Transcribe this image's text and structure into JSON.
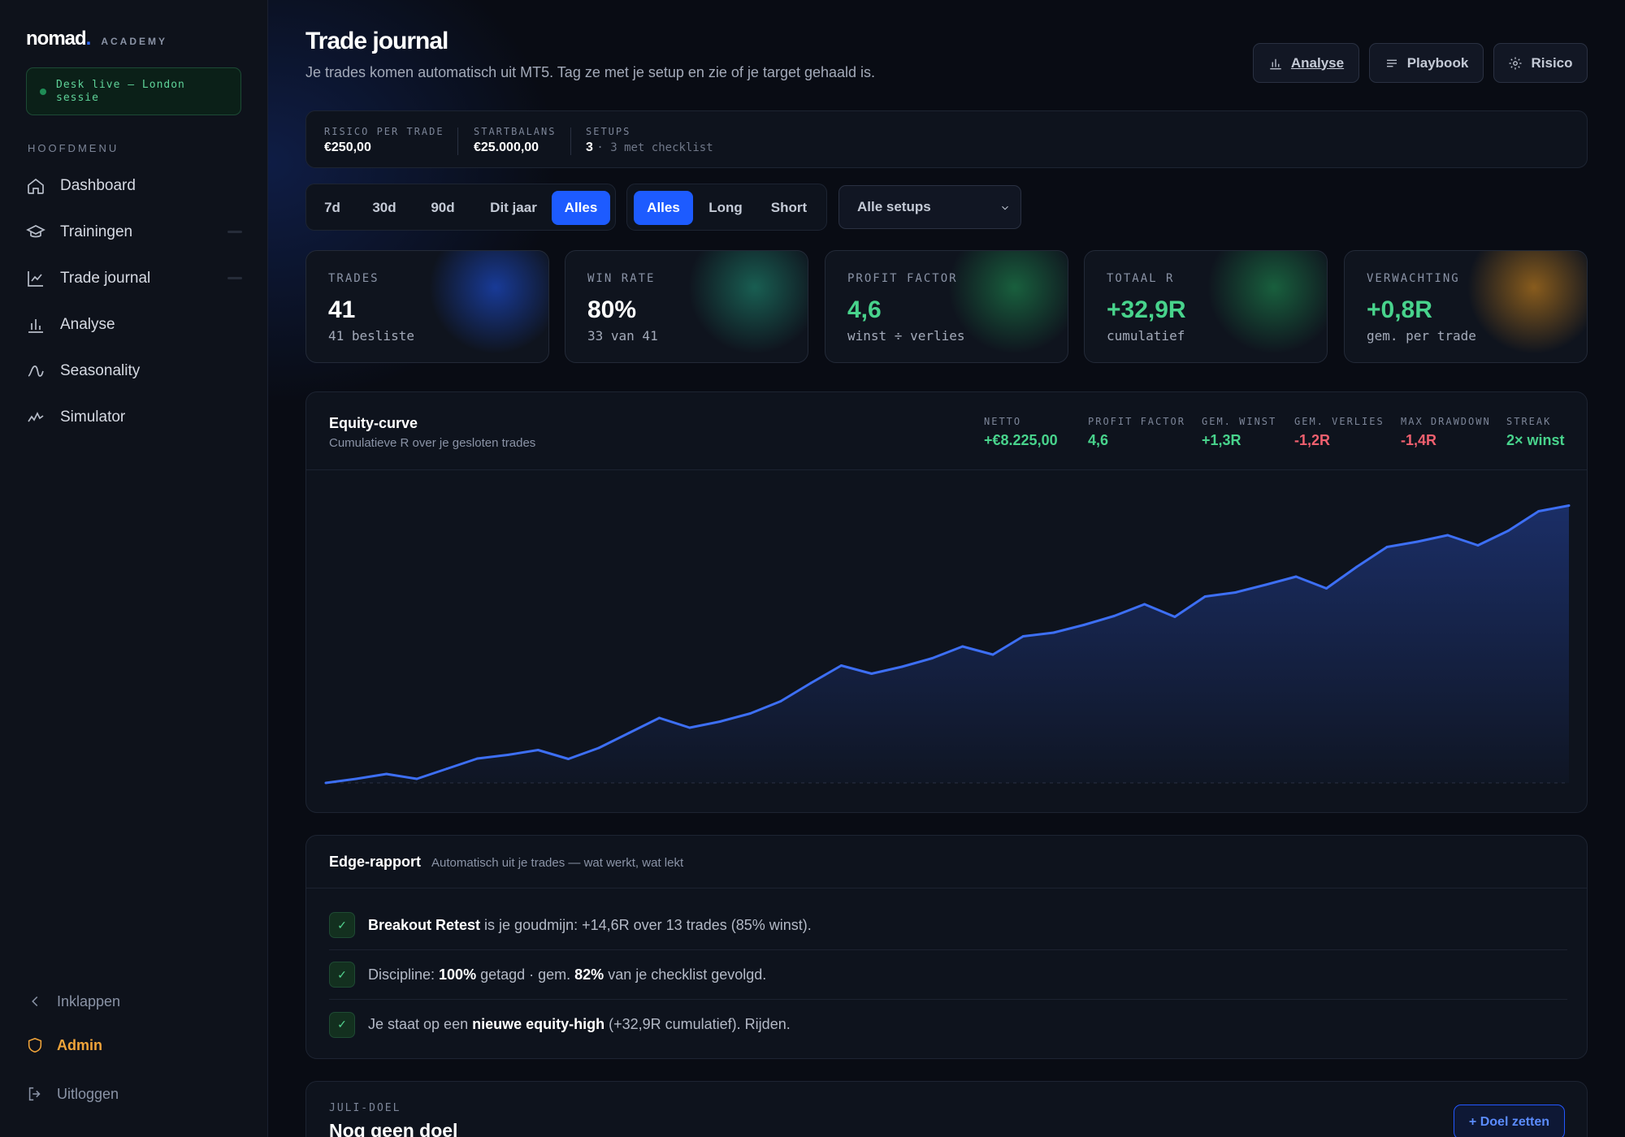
{
  "brand": {
    "name": "nomad",
    "dot": ".",
    "sub": "ACADEMY"
  },
  "live_status": "Desk live – London sessie",
  "sidebar": {
    "menu_title": "HOOFDMENU",
    "items": [
      {
        "label": "Dashboard",
        "icon": "home-icon"
      },
      {
        "label": "Trainingen",
        "icon": "graduation-cap-icon"
      },
      {
        "label": "Trade journal",
        "icon": "line-chart-icon"
      },
      {
        "label": "Analyse",
        "icon": "bar-chart-icon"
      },
      {
        "label": "Seasonality",
        "icon": "wave-icon"
      },
      {
        "label": "Simulator",
        "icon": "activity-icon"
      }
    ],
    "collapse": "Inklappen",
    "admin": "Admin",
    "logout": "Uitloggen"
  },
  "header": {
    "title": "Trade journal",
    "subtitle": "Je trades komen automatisch uit MT5. Tag ze met je setup en zie of je target gehaald is.",
    "buttons": {
      "analyse": "Analyse",
      "playbook": "Playbook",
      "risico": "Risico"
    }
  },
  "info": {
    "risk_label": "RISICO PER TRADE",
    "risk_value": "€250,00",
    "balance_label": "STARTBALANS",
    "balance_value": "€25.000,00",
    "setups_label": "SETUPS",
    "setups_value": "3",
    "setups_sub": "· 3 met checklist"
  },
  "filters": {
    "periods": [
      "7d",
      "30d",
      "90d",
      "Dit jaar",
      "Alles"
    ],
    "period_active": "Alles",
    "directions": [
      "Alles",
      "Long",
      "Short"
    ],
    "direction_active": "Alles",
    "setup_select": "Alle setups"
  },
  "kpis": [
    {
      "label": "TRADES",
      "value": "41",
      "sub": "41 besliste",
      "glow": "#1d4fd8"
    },
    {
      "label": "WIN RATE",
      "value": "80%",
      "sub": "33 van 41",
      "glow": "#1f8f74"
    },
    {
      "label": "PROFIT FACTOR",
      "value": "4,6",
      "sub": "winst ÷ verlies",
      "glow": "#1f9152"
    },
    {
      "label": "TOTAAL R",
      "value": "+32,9R",
      "sub": "cumulatief",
      "glow": "#1f9152"
    },
    {
      "label": "VERWACHTING",
      "value": "+0,8R",
      "sub": "gem. per trade",
      "glow": "#c9821c"
    }
  ],
  "equity": {
    "title": "Equity-curve",
    "subtitle": "Cumulatieve R over je gesloten trades",
    "stats": [
      {
        "label": "NETTO",
        "value": "+€8.225,00",
        "color": "#48d38c"
      },
      {
        "label": "PROFIT FACTOR",
        "value": "4,6",
        "color": "#48d38c"
      },
      {
        "label": "GEM. WINST",
        "value": "+1,3R",
        "color": "#48d38c"
      },
      {
        "label": "GEM. VERLIES",
        "value": "-1,2R",
        "color": "#f0606f"
      },
      {
        "label": "MAX DRAWDOWN",
        "value": "-1,4R",
        "color": "#f0606f"
      },
      {
        "label": "STREAK",
        "value": "2× winst",
        "color": "#48d38c"
      }
    ]
  },
  "chart_data": {
    "type": "area",
    "title": "Equity-curve",
    "x": [
      0,
      1,
      2,
      3,
      4,
      5,
      6,
      7,
      8,
      9,
      10,
      11,
      12,
      13,
      14,
      15,
      16,
      17,
      18,
      19,
      20,
      21,
      22,
      23,
      24,
      25,
      26,
      27,
      28,
      29,
      30,
      31,
      32,
      33,
      34,
      35,
      36,
      37,
      38,
      39,
      40,
      41
    ],
    "y": [
      0,
      1.0,
      2.2,
      1.0,
      3.5,
      6.0,
      6.9,
      8.1,
      5.9,
      8.6,
      12.3,
      16.0,
      13.6,
      15.1,
      17.1,
      20.1,
      24.6,
      28.9,
      26.9,
      28.6,
      30.7,
      33.6,
      31.6,
      36.1,
      37.0,
      38.9,
      41.1,
      44.0,
      40.9,
      45.9,
      46.9,
      48.8,
      50.8,
      47.9,
      53.2,
      58.1,
      59.4,
      61.0,
      58.5,
      62.1,
      66.9,
      68.3
    ],
    "ylim": [
      0,
      70
    ],
    "grid": false,
    "legend": "none",
    "color": "#3d6ff5"
  },
  "edge": {
    "title": "Edge-rapport",
    "subtitle": "Automatisch uit je trades — wat werkt, wat lekt",
    "rows": [
      {
        "check": "✓",
        "b1": "Breakout Retest",
        "t1": " is je goudmijn: +14,6R over 13 trades (85% winst).",
        "b2": "",
        "t2": "",
        "b3": "",
        "t3": "",
        "p1": ""
      },
      {
        "check": "✓",
        "p1": "Discipline: ",
        "b1": "100%",
        "t1": " getagd · gem. ",
        "b2": "82%",
        "t2": " van je checklist gevolgd.",
        "b3": "",
        "t3": ""
      },
      {
        "check": "✓",
        "p1": "Je staat op een ",
        "b1": "nieuwe equity-high",
        "t1": " (+32,9R cumulatief). Rijden.",
        "b2": "",
        "t2": "",
        "b3": "",
        "t3": ""
      }
    ]
  },
  "goal": {
    "label": "JULI-DOEL",
    "title": "Nog geen doel",
    "button": "+ Doel zetten"
  }
}
